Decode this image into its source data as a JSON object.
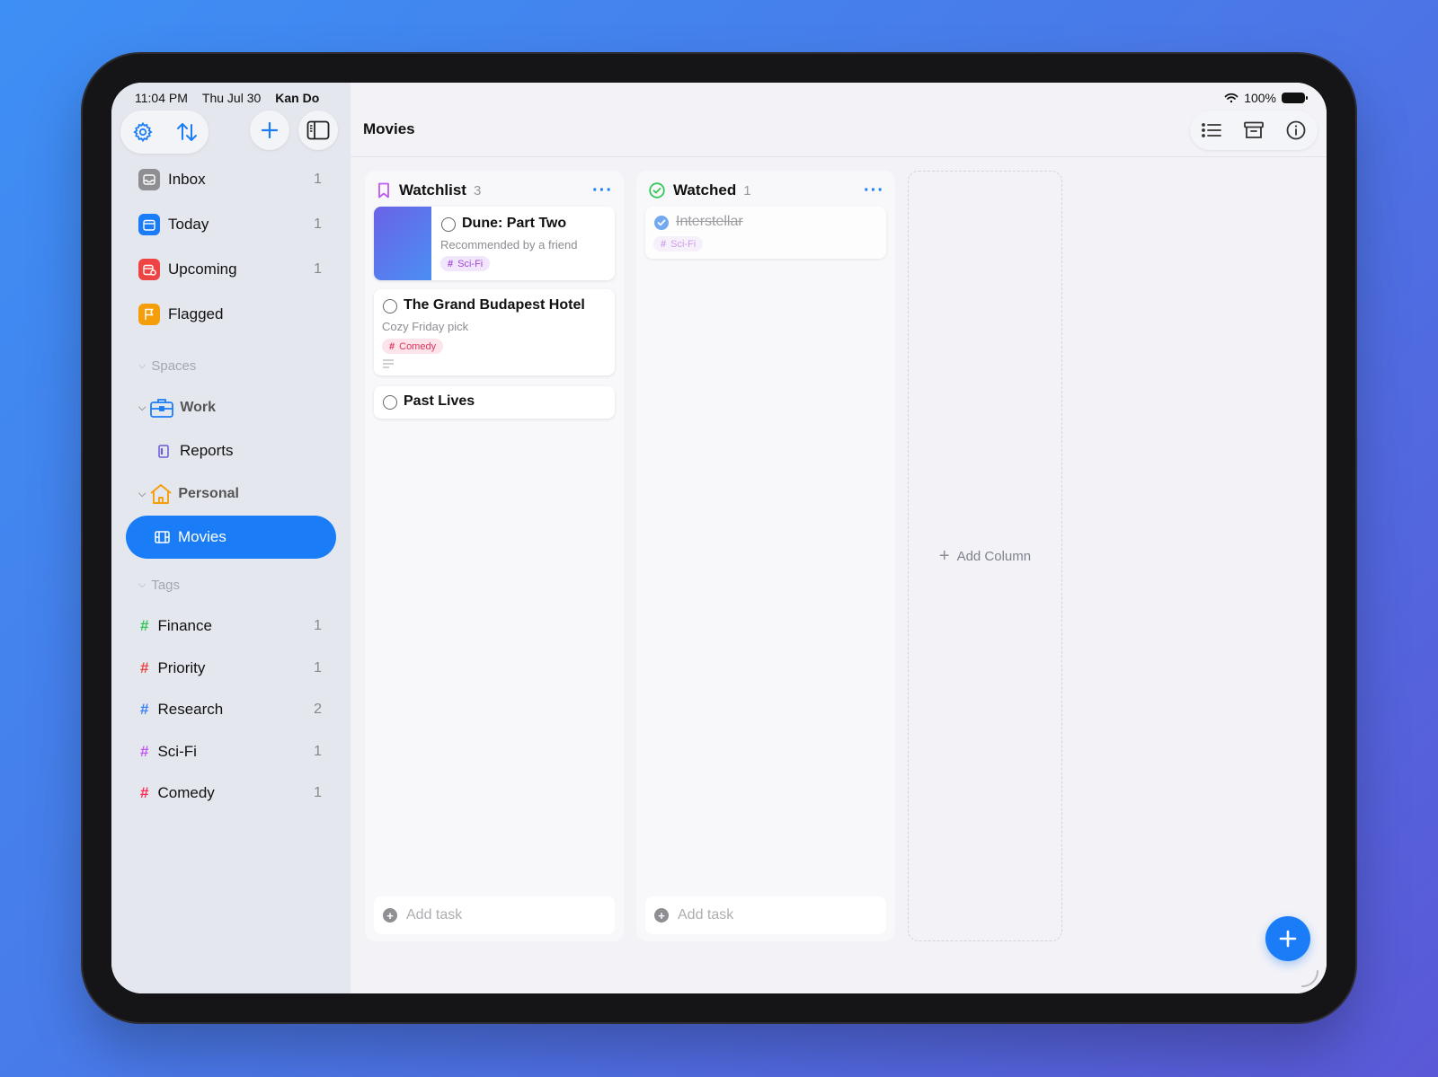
{
  "status_bar": {
    "time": "11:04 PM",
    "date": "Thu Jul 30",
    "app_name": "Kan Do",
    "battery": "100%"
  },
  "sidebar": {
    "toolbar": {
      "settings_icon": "gear-icon",
      "sort_icon": "sort-arrows-icon",
      "add_icon": "plus-icon",
      "sidebar_toggle_icon": "sidebar-toggle-icon"
    },
    "smart_lists": [
      {
        "label": "Inbox",
        "count": "1",
        "icon": "inbox-icon",
        "color": "#8e8e93"
      },
      {
        "label": "Today",
        "count": "1",
        "icon": "calendar-icon",
        "color": "#1a7df7"
      },
      {
        "label": "Upcoming",
        "count": "1",
        "icon": "calendar-clock-icon",
        "color": "#ef4444"
      },
      {
        "label": "Flagged",
        "count": "",
        "icon": "flag-icon",
        "color": "#f59e0b"
      }
    ],
    "spaces_header": "Spaces",
    "spaces": [
      {
        "label": "Work",
        "icon": "briefcase-icon",
        "lists": [
          {
            "label": "Reports",
            "icon": "document-icon"
          }
        ]
      },
      {
        "label": "Personal",
        "icon": "house-icon",
        "lists": [
          {
            "label": "Movies",
            "icon": "film-icon",
            "active": true
          }
        ]
      }
    ],
    "tags_header": "Tags",
    "tags": [
      {
        "label": "Finance",
        "count": "1",
        "color": "#34c759"
      },
      {
        "label": "Priority",
        "count": "1",
        "color": "#ef4444"
      },
      {
        "label": "Research",
        "count": "2",
        "color": "#3b82f6"
      },
      {
        "label": "Sci-Fi",
        "count": "1",
        "color": "#bf5af2"
      },
      {
        "label": "Comedy",
        "count": "1",
        "color": "#ff2d55"
      }
    ]
  },
  "main": {
    "title": "Movies",
    "tools": {
      "list_icon": "list-icon",
      "archive_icon": "archive-icon",
      "info_icon": "info-icon"
    },
    "columns": [
      {
        "title": "Watchlist",
        "count": "3",
        "icon": "bookmark-icon",
        "more": "···",
        "cards": [
          {
            "title": "Dune: Part Two",
            "note": "Recommended by a friend",
            "tag": "Sci-Fi",
            "has_image": true
          },
          {
            "title": "The Grand Budapest Hotel",
            "note": "Cozy Friday pick",
            "tag": "Comedy",
            "has_notes_icon": true
          },
          {
            "title": "Past Lives",
            "note": "",
            "tag": ""
          }
        ],
        "add_task": "Add task"
      },
      {
        "title": "Watched",
        "count": "1",
        "icon": "check-circle-icon",
        "more": "···",
        "cards": [
          {
            "title": "Interstellar",
            "note": "",
            "tag": "Sci-Fi",
            "completed": true
          }
        ],
        "add_task": "Add task"
      }
    ],
    "add_column": "Add Column",
    "fab_icon": "plus-icon"
  },
  "colors": {
    "accent": "#1a7df7",
    "scifi_tag_bg": "#f1e6fb",
    "comedy_tag_bg": "#fde4ea"
  }
}
